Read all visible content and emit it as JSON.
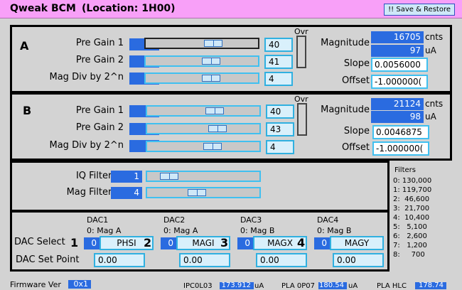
{
  "title": "Qweak BCM",
  "location": "(Location: 1H00)",
  "save_restore_label": "!! Save & Restore",
  "labels": {
    "pre_gain_1": "Pre Gain 1",
    "pre_gain_2": "Pre Gain 2",
    "mag_div": "Mag Div by 2^n",
    "ovr": "Ovr",
    "magnitude": "Magnitude",
    "slope": "Slope",
    "offset": "Offset",
    "cnts": "cnts",
    "ua": "uA",
    "iq_filter": "IQ Filter K",
    "mag_filter": "Mag Filter K",
    "dac_select": "DAC Select",
    "dac_set_point": "DAC Set Point",
    "filters_title": "Filters",
    "firmware": "Firmware Ver"
  },
  "channel_a": {
    "name": "A",
    "pre_gain_1": "40",
    "pre_gain_1_entry": "40",
    "pre_gain_2": "41",
    "pre_gain_2_entry": "41",
    "mag_div": "4",
    "mag_div_entry": "4",
    "magnitude_cnts": "16705",
    "magnitude_ua": "97",
    "slope": "0.0056000",
    "offset": "-1.000000(",
    "slider_levels": [
      0.62,
      0.6,
      0.6
    ]
  },
  "channel_b": {
    "name": "B",
    "pre_gain_1": "40",
    "pre_gain_1_entry": "40",
    "pre_gain_2": "43",
    "pre_gain_2_entry": "43",
    "mag_div": "4",
    "mag_div_entry": "4",
    "magnitude_cnts": "21124",
    "magnitude_ua": "98",
    "slope": "0.0046875",
    "offset": "-1.000000(",
    "slider_levels": [
      0.62,
      0.65,
      0.6
    ]
  },
  "filters_panel": {
    "iq_filter_k": "1",
    "mag_filter_k": "4",
    "slider_levels": [
      0.14,
      0.43
    ]
  },
  "filters_list": [
    "0: 130,000",
    "1: 119,700",
    "2:  46,600",
    "3:  21,700",
    "4:  10,400",
    "5:   5,100",
    "6:   2,600",
    "7:   1,200",
    "8:     700"
  ],
  "dacs": [
    {
      "title": "DAC1",
      "sub": "0: Mag A",
      "num": "1",
      "sel": "0",
      "signal": "PHSI",
      "setpoint": "0.00"
    },
    {
      "title": "DAC2",
      "sub": "0: Mag A",
      "num": "2",
      "sel": "0",
      "signal": "MAGI",
      "setpoint": "0.00"
    },
    {
      "title": "DAC3",
      "sub": "0: Mag B",
      "num": "3",
      "sel": "0",
      "signal": "MAGX",
      "setpoint": "0.00"
    },
    {
      "title": "DAC4",
      "sub": "0: Mag B",
      "num": "4",
      "sel": "0",
      "signal": "MAGY",
      "setpoint": "0.00"
    }
  ],
  "footer": {
    "firmware_value": "0x1",
    "ipc_label": "IPC0L03",
    "ipc_value": "173.912",
    "ipc_unit": "uA",
    "pla_label": "PLA 0P07",
    "pla_value": "180.54",
    "pla_unit": "uA",
    "plah_label": "PLA HLC",
    "plah_value": "178.74"
  }
}
